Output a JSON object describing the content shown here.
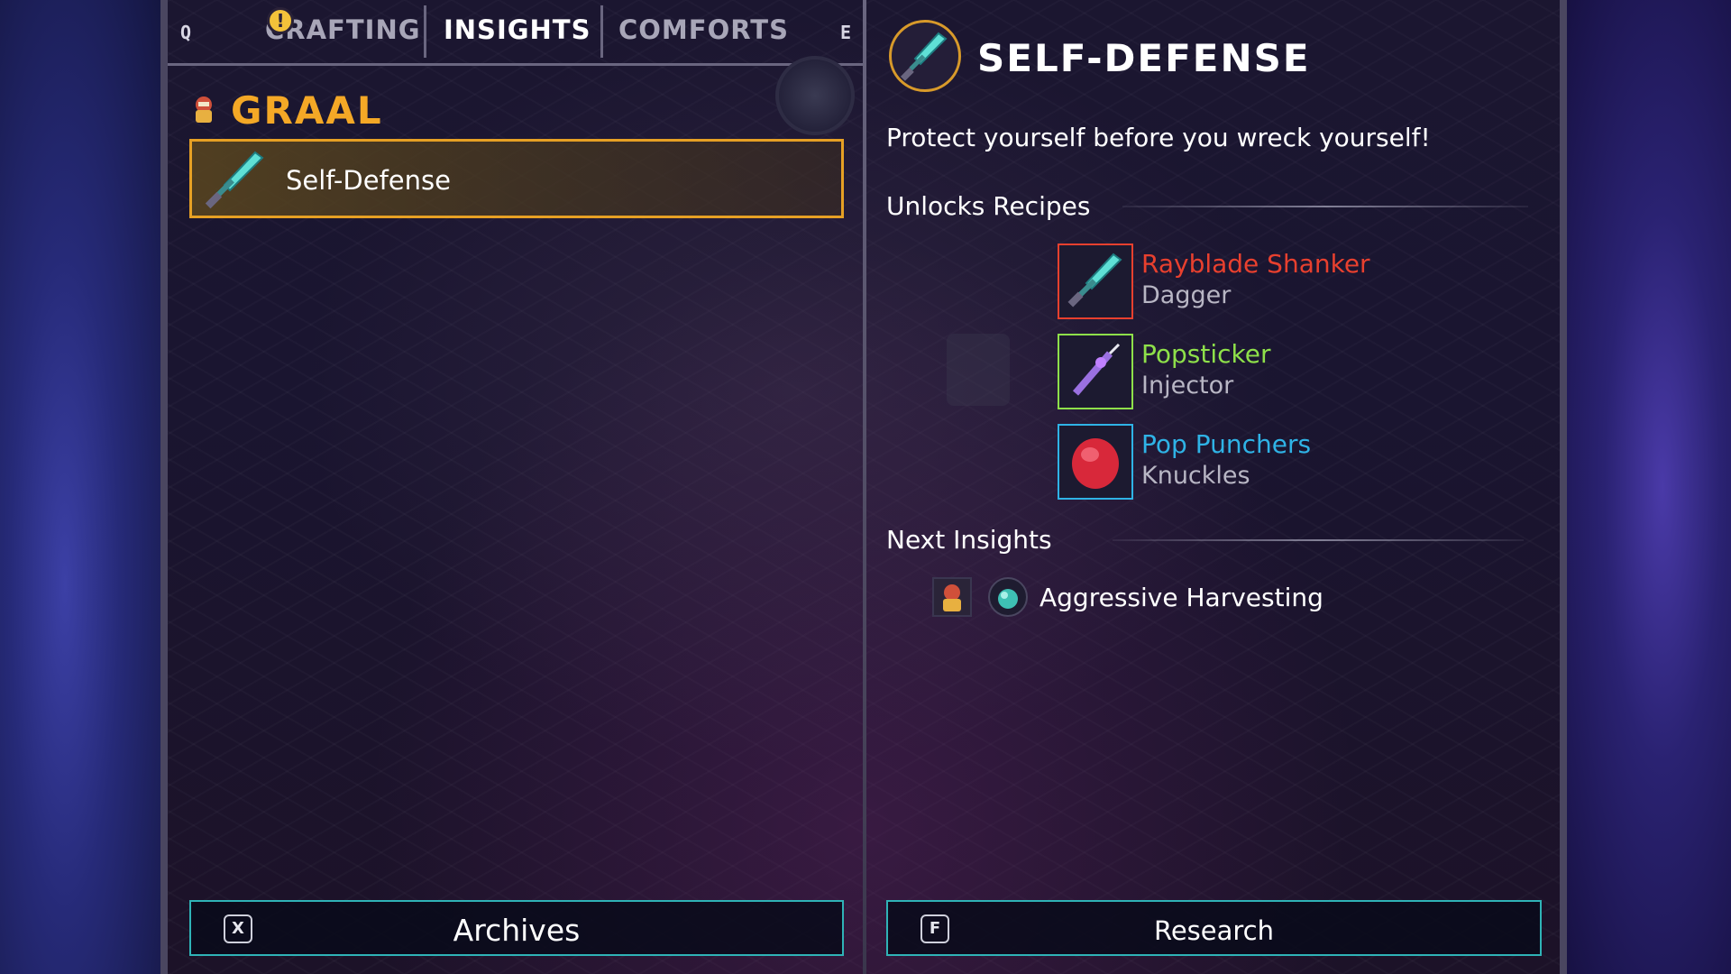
{
  "tabs": {
    "prev_key": "Q",
    "next_key": "E",
    "items": [
      {
        "label": "CRAFTING",
        "active": false,
        "alert": "!"
      },
      {
        "label": "INSIGHTS",
        "active": true
      },
      {
        "label": "COMFORTS",
        "active": false
      }
    ]
  },
  "left_panel": {
    "category": {
      "name": "GRAAL",
      "icon": "graal-character-icon",
      "color": "#f4a826"
    },
    "insights": [
      {
        "label": "Self-Defense",
        "icon": "sword-icon",
        "selected": true
      }
    ],
    "archives_button": {
      "key": "X",
      "label": "Archives"
    }
  },
  "detail": {
    "title": "SELF-DEFENSE",
    "icon": "sword-icon",
    "description": "Protect yourself before you wreck yourself!",
    "unlocks_heading": "Unlocks Recipes",
    "recipes": [
      {
        "name": "Rayblade Shanker",
        "type": "Dagger",
        "color": "#e8402e",
        "icon": "dagger-icon"
      },
      {
        "name": "Popsticker",
        "type": "Injector",
        "color": "#8ee04a",
        "icon": "injector-icon"
      },
      {
        "name": "Pop Punchers",
        "type": "Knuckles",
        "color": "#2fb3e6",
        "icon": "knuckles-icon"
      }
    ],
    "next_heading": "Next Insights",
    "next_insights": [
      {
        "label": "Aggressive Harvesting",
        "icons": [
          "graal-character-icon",
          "teal-orb-icon"
        ]
      }
    ],
    "research_button": {
      "key": "F",
      "label": "Research"
    }
  },
  "colors": {
    "accent_gold": "#e6a024",
    "button_border": "#2fb3b7"
  }
}
